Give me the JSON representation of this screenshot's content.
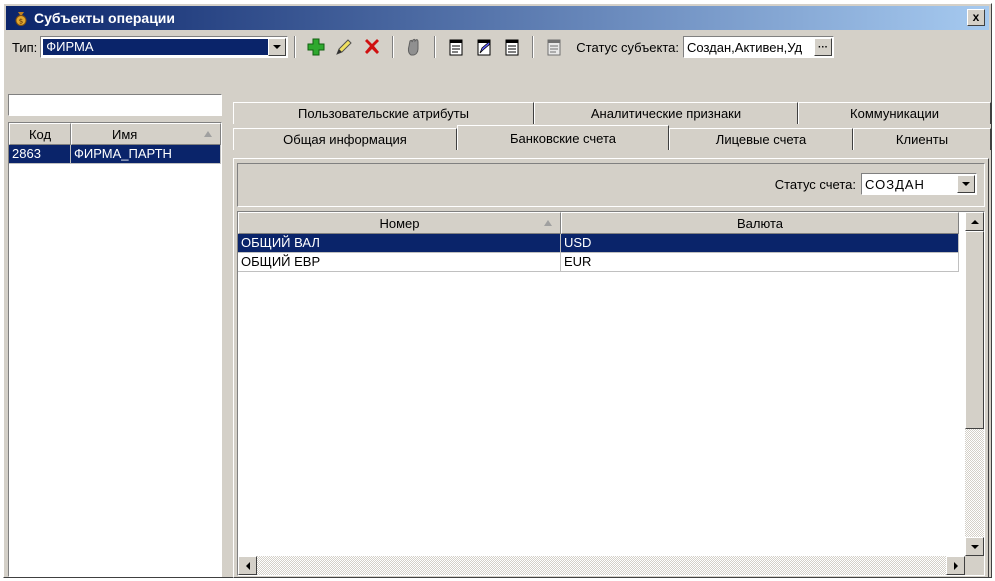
{
  "window": {
    "title": "Субъекты операции",
    "close_label": "x"
  },
  "toolbar": {
    "type_label": "Тип:",
    "type_value": "ФИРМА",
    "status_label": "Статус субъекта:",
    "status_value": "Создан,Активен,Уд",
    "ellipsis_label": "···",
    "icons": [
      "add-icon",
      "edit-icon",
      "delete-icon",
      "hand-icon",
      "doc-icon",
      "doc-edit-icon",
      "doc-list-icon",
      "doc-icon"
    ]
  },
  "left": {
    "search_value": "",
    "columns": [
      "Код",
      "Имя"
    ],
    "rows": [
      {
        "code": "2863",
        "name": "ФИРМА_ПАРТН"
      }
    ]
  },
  "tabs": {
    "row1": [
      "Пользовательские атрибуты",
      "Аналитические признаки",
      "Коммуникации"
    ],
    "row2": [
      "Общая информация",
      "Банковские счета",
      "Лицевые счета",
      "Клиенты"
    ],
    "active": "Банковские счета"
  },
  "accounts": {
    "status_label": "Статус счета:",
    "status_value": "СОЗДАН",
    "columns": [
      "Номер",
      "Валюта"
    ],
    "rows": [
      {
        "number": "ОБЩИЙ ВАЛ",
        "currency": "USD"
      },
      {
        "number": "ОБЩИЙ ЕВР",
        "currency": "EUR"
      }
    ]
  },
  "colors": {
    "selection": "#0a246a",
    "face": "#d4d0c8",
    "title_end": "#a6caf0"
  }
}
